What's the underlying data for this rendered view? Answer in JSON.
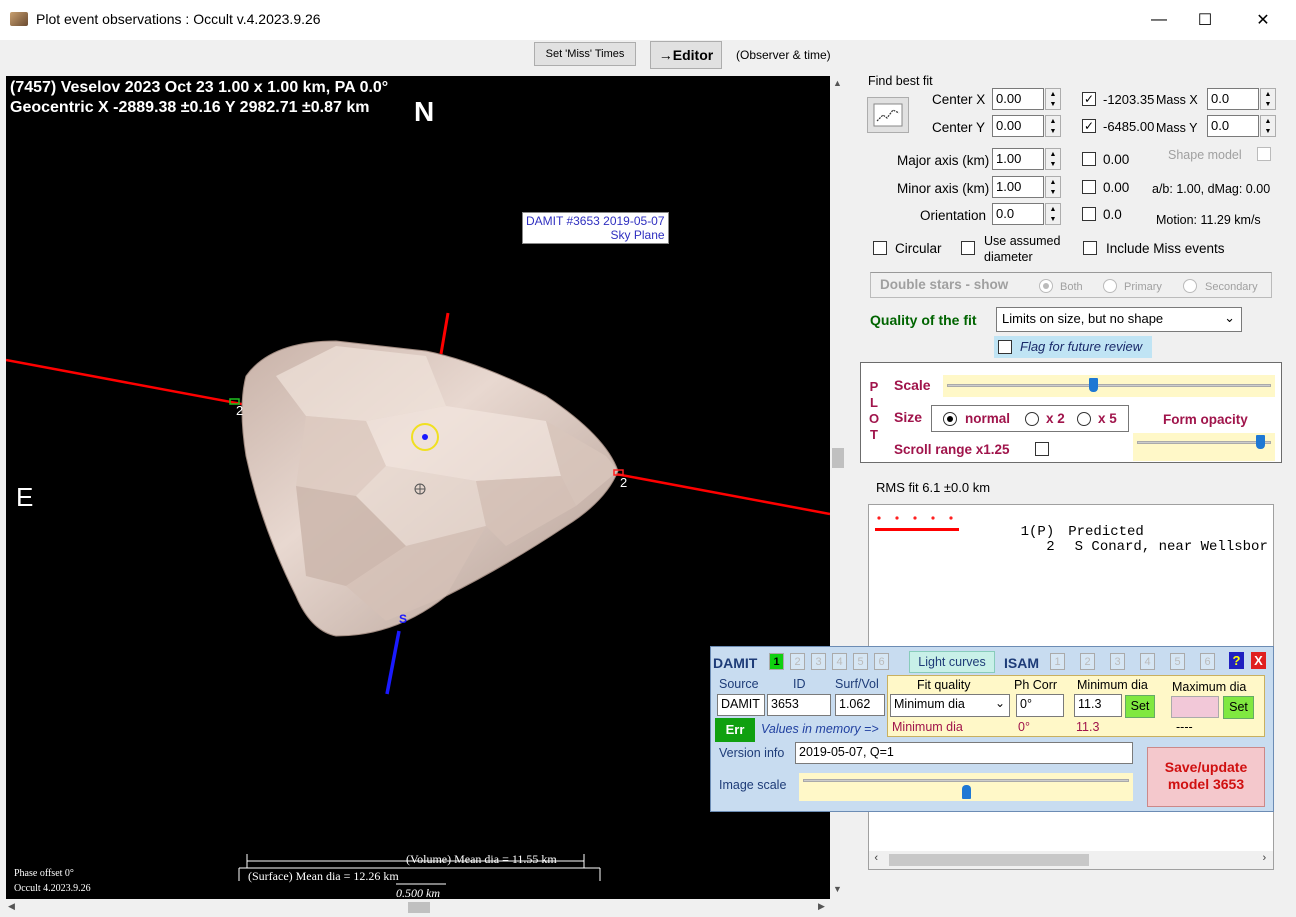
{
  "window": {
    "title": "Plot event observations : Occult v.4.2023.9.26",
    "minimize": "—",
    "maximize": "☐",
    "close": "✕"
  },
  "toolbar": {
    "set_miss_times": "Set 'Miss' Times",
    "editor": "→Editor",
    "observer_time": "(Observer & time)"
  },
  "plot": {
    "header_line1": "(7457) Veselov  2023 Oct 23   1.00 x 1.00 km, PA 0.0°",
    "header_line2": "Geocentric  X  -2889.38 ±0.16  Y 2982.71 ±0.87 km",
    "north": "N",
    "east": "E",
    "south": "S",
    "damit_label_1": "DAMIT #3653 2019-05-07",
    "damit_label_2": "Sky Plane",
    "chord_label_left": "2",
    "chord_label_right": "2",
    "volume_dia": "(Volume) Mean dia = 11.55 km",
    "surface_dia": "(Surface) Mean dia = 12.26 km",
    "scale_bar": "0.500 km",
    "phase_offset": "Phase offset 0°",
    "version": "Occult 4.2023.9.26"
  },
  "fit": {
    "find_best_fit": "Find best fit",
    "center_x_label": "Center X",
    "center_x": "0.00",
    "center_y_label": "Center Y",
    "center_y": "0.00",
    "x_readout": "-1203.35",
    "y_readout": "-6485.00",
    "mass_x_label": "Mass X",
    "mass_x": "0.0",
    "mass_y_label": "Mass Y",
    "mass_y": "0.0",
    "major_axis_label": "Major axis (km)",
    "major_axis": "1.00",
    "major_readout": "0.00",
    "minor_axis_label": "Minor axis (km)",
    "minor_axis": "1.00",
    "minor_readout": "0.00",
    "orientation_label": "Orientation",
    "orientation": "0.0",
    "orientation_readout": "0.0",
    "shape_model": "Shape model",
    "ab_dmag": "a/b: 1.00, dMag: 0.00",
    "motion": "Motion: 11.29 km/s",
    "circular": "Circular",
    "use_assumed_1": "Use assumed",
    "use_assumed_2": "diameter",
    "include_miss": "Include Miss events",
    "double_stars": "Double stars - show",
    "both": "Both",
    "primary": "Primary",
    "secondary": "Secondary",
    "quality_label": "Quality of the fit",
    "quality_value": "Limits on size, but no shape",
    "flag_review": "Flag for future review"
  },
  "plotpanel": {
    "plot_letters": [
      "P",
      "L",
      "O",
      "T"
    ],
    "scale": "Scale",
    "scale_level": 0.45,
    "size": "Size",
    "normal": "normal",
    "x2": "x 2",
    "x5": "x 5",
    "form_opacity": "Form opacity",
    "opacity_level": 0.95,
    "scroll_range": "Scroll range x1.25"
  },
  "rms": "RMS fit 6.1 ±0.0 km",
  "legend": {
    "rows": [
      {
        "num": "1(P)",
        "name": "Predicted"
      },
      {
        "num": "2",
        "name": "S Conard, near Wellsbor"
      }
    ]
  },
  "damit": {
    "title": "DAMIT",
    "nums": [
      "1",
      "2",
      "3",
      "4",
      "5",
      "6"
    ],
    "light_curves": "Light curves",
    "isam": "ISAM",
    "isam_nums": [
      "1",
      "2",
      "3",
      "4",
      "5",
      "6"
    ],
    "help": "?",
    "close": "X",
    "source_label": "Source",
    "id_label": "ID",
    "surf_vol_label": "Surf/Vol",
    "source": "DAMIT",
    "id": "3653",
    "surf_vol": "1.062",
    "err": "Err",
    "values_in_memory": "Values in memory =>",
    "fit_quality_label": "Fit quality",
    "fit_quality": "Minimum dia",
    "fit_quality_mem": "Minimum dia",
    "ph_corr_label": "Ph Corr",
    "ph_corr": "0°",
    "ph_corr_mem": "0°",
    "min_dia_label": "Minimum dia",
    "min_dia": "11.3",
    "min_dia_mem": "11.3",
    "set": "Set",
    "max_dia_label": "Maximum dia",
    "max_dia_mem": "----",
    "version_info_label": "Version info",
    "version_info": "2019-05-07, Q=1",
    "image_scale_label": "Image scale",
    "image_scale_level": 0.5,
    "save_1": "Save/update",
    "save_2": "model 3653"
  }
}
